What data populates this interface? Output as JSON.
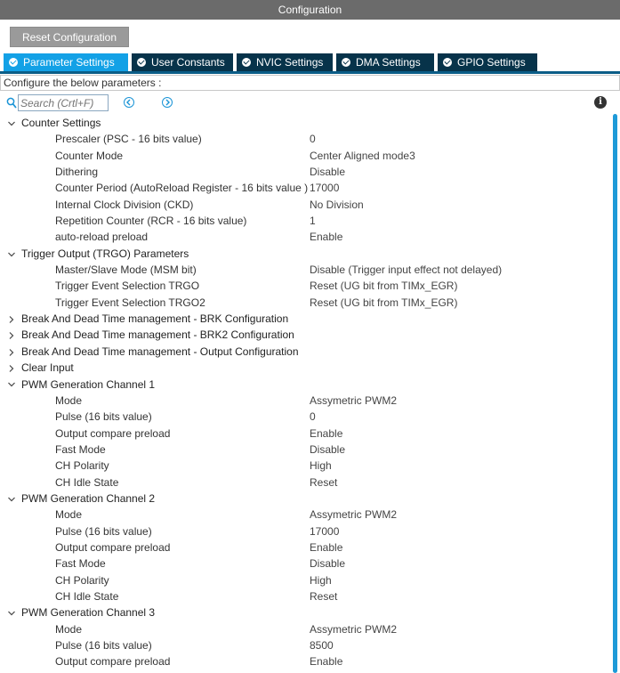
{
  "window": {
    "title": "Configuration"
  },
  "toolbar": {
    "reset_label": "Reset Configuration"
  },
  "tabs": [
    {
      "label": "Parameter Settings",
      "active": true
    },
    {
      "label": "User Constants",
      "active": false
    },
    {
      "label": "NVIC Settings",
      "active": false
    },
    {
      "label": "DMA Settings",
      "active": false
    },
    {
      "label": "GPIO Settings",
      "active": false
    }
  ],
  "hint": "Configure the below parameters :",
  "search": {
    "placeholder": "Search (Crtl+F)"
  },
  "groups": [
    {
      "label": "Counter Settings",
      "expanded": true,
      "params": [
        {
          "name": "Prescaler (PSC - 16 bits value)",
          "value": "0"
        },
        {
          "name": "Counter Mode",
          "value": "Center Aligned mode3"
        },
        {
          "name": "Dithering",
          "value": "Disable"
        },
        {
          "name": "Counter Period (AutoReload Register - 16 bits value )",
          "value": "17000"
        },
        {
          "name": "Internal Clock Division (CKD)",
          "value": "No Division"
        },
        {
          "name": "Repetition Counter (RCR - 16 bits value)",
          "value": "1"
        },
        {
          "name": "auto-reload preload",
          "value": "Enable"
        }
      ]
    },
    {
      "label": "Trigger Output (TRGO) Parameters",
      "expanded": true,
      "params": [
        {
          "name": "Master/Slave Mode (MSM bit)",
          "value": "Disable (Trigger input effect not delayed)"
        },
        {
          "name": "Trigger Event Selection TRGO",
          "value": "Reset (UG bit from TIMx_EGR)"
        },
        {
          "name": "Trigger Event Selection TRGO2",
          "value": "Reset (UG bit from TIMx_EGR)"
        }
      ]
    },
    {
      "label": "Break And Dead Time management - BRK Configuration",
      "expanded": false,
      "params": []
    },
    {
      "label": "Break And Dead Time management - BRK2 Configuration",
      "expanded": false,
      "params": []
    },
    {
      "label": "Break And Dead Time management - Output Configuration",
      "expanded": false,
      "params": []
    },
    {
      "label": "Clear Input",
      "expanded": false,
      "params": []
    },
    {
      "label": "PWM Generation Channel 1",
      "expanded": true,
      "params": [
        {
          "name": "Mode",
          "value": "Assymetric PWM2"
        },
        {
          "name": "Pulse (16 bits value)",
          "value": "0"
        },
        {
          "name": "Output compare preload",
          "value": "Enable"
        },
        {
          "name": "Fast Mode",
          "value": "Disable"
        },
        {
          "name": "CH Polarity",
          "value": "High"
        },
        {
          "name": "CH Idle State",
          "value": "Reset"
        }
      ]
    },
    {
      "label": "PWM Generation Channel 2",
      "expanded": true,
      "params": [
        {
          "name": "Mode",
          "value": "Assymetric PWM2"
        },
        {
          "name": "Pulse (16 bits value)",
          "value": "17000"
        },
        {
          "name": "Output compare preload",
          "value": "Enable"
        },
        {
          "name": "Fast Mode",
          "value": "Disable"
        },
        {
          "name": "CH Polarity",
          "value": "High"
        },
        {
          "name": "CH Idle State",
          "value": "Reset"
        }
      ]
    },
    {
      "label": "PWM Generation Channel 3",
      "expanded": true,
      "params": [
        {
          "name": "Mode",
          "value": "Assymetric PWM2"
        },
        {
          "name": "Pulse (16 bits value)",
          "value": "8500"
        },
        {
          "name": "Output compare preload",
          "value": "Enable"
        }
      ]
    }
  ],
  "colors": {
    "active_tab": "#13a1e6",
    "inactive_tab": "#07334a",
    "titlebar": "#6b6b6b",
    "scroll_thumb": "#1e9ad8"
  },
  "icons": {
    "search": "search-icon",
    "prev": "chevron-left-icon",
    "next": "chevron-right-icon",
    "info": "info-icon"
  }
}
